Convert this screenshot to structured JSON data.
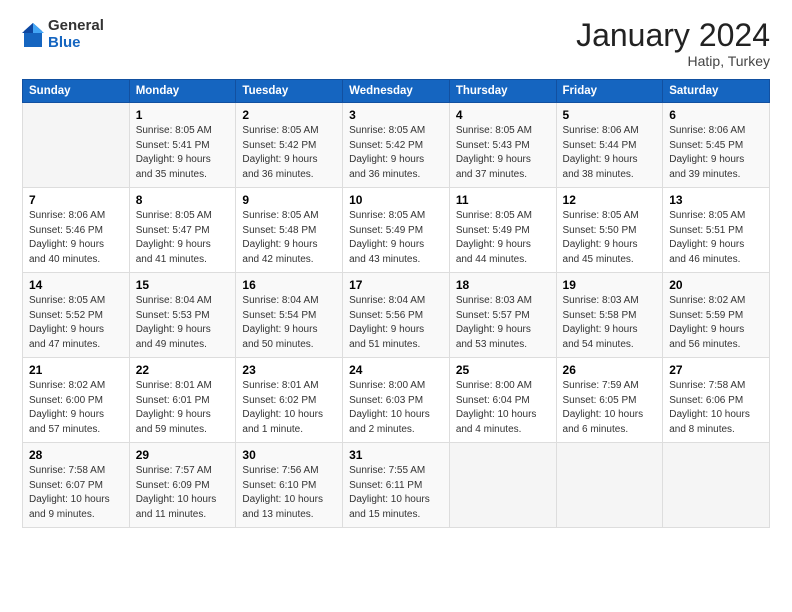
{
  "header": {
    "logo": {
      "general": "General",
      "blue": "Blue"
    },
    "title": "January 2024",
    "location": "Hatip, Turkey"
  },
  "days_of_week": [
    "Sunday",
    "Monday",
    "Tuesday",
    "Wednesday",
    "Thursday",
    "Friday",
    "Saturday"
  ],
  "weeks": [
    [
      {
        "day": "",
        "sunrise": "",
        "sunset": "",
        "daylight": ""
      },
      {
        "day": "1",
        "sunrise": "Sunrise: 8:05 AM",
        "sunset": "Sunset: 5:41 PM",
        "daylight": "Daylight: 9 hours and 35 minutes."
      },
      {
        "day": "2",
        "sunrise": "Sunrise: 8:05 AM",
        "sunset": "Sunset: 5:42 PM",
        "daylight": "Daylight: 9 hours and 36 minutes."
      },
      {
        "day": "3",
        "sunrise": "Sunrise: 8:05 AM",
        "sunset": "Sunset: 5:42 PM",
        "daylight": "Daylight: 9 hours and 36 minutes."
      },
      {
        "day": "4",
        "sunrise": "Sunrise: 8:05 AM",
        "sunset": "Sunset: 5:43 PM",
        "daylight": "Daylight: 9 hours and 37 minutes."
      },
      {
        "day": "5",
        "sunrise": "Sunrise: 8:06 AM",
        "sunset": "Sunset: 5:44 PM",
        "daylight": "Daylight: 9 hours and 38 minutes."
      },
      {
        "day": "6",
        "sunrise": "Sunrise: 8:06 AM",
        "sunset": "Sunset: 5:45 PM",
        "daylight": "Daylight: 9 hours and 39 minutes."
      }
    ],
    [
      {
        "day": "7",
        "sunrise": "Sunrise: 8:06 AM",
        "sunset": "Sunset: 5:46 PM",
        "daylight": "Daylight: 9 hours and 40 minutes."
      },
      {
        "day": "8",
        "sunrise": "Sunrise: 8:05 AM",
        "sunset": "Sunset: 5:47 PM",
        "daylight": "Daylight: 9 hours and 41 minutes."
      },
      {
        "day": "9",
        "sunrise": "Sunrise: 8:05 AM",
        "sunset": "Sunset: 5:48 PM",
        "daylight": "Daylight: 9 hours and 42 minutes."
      },
      {
        "day": "10",
        "sunrise": "Sunrise: 8:05 AM",
        "sunset": "Sunset: 5:49 PM",
        "daylight": "Daylight: 9 hours and 43 minutes."
      },
      {
        "day": "11",
        "sunrise": "Sunrise: 8:05 AM",
        "sunset": "Sunset: 5:49 PM",
        "daylight": "Daylight: 9 hours and 44 minutes."
      },
      {
        "day": "12",
        "sunrise": "Sunrise: 8:05 AM",
        "sunset": "Sunset: 5:50 PM",
        "daylight": "Daylight: 9 hours and 45 minutes."
      },
      {
        "day": "13",
        "sunrise": "Sunrise: 8:05 AM",
        "sunset": "Sunset: 5:51 PM",
        "daylight": "Daylight: 9 hours and 46 minutes."
      }
    ],
    [
      {
        "day": "14",
        "sunrise": "Sunrise: 8:05 AM",
        "sunset": "Sunset: 5:52 PM",
        "daylight": "Daylight: 9 hours and 47 minutes."
      },
      {
        "day": "15",
        "sunrise": "Sunrise: 8:04 AM",
        "sunset": "Sunset: 5:53 PM",
        "daylight": "Daylight: 9 hours and 49 minutes."
      },
      {
        "day": "16",
        "sunrise": "Sunrise: 8:04 AM",
        "sunset": "Sunset: 5:54 PM",
        "daylight": "Daylight: 9 hours and 50 minutes."
      },
      {
        "day": "17",
        "sunrise": "Sunrise: 8:04 AM",
        "sunset": "Sunset: 5:56 PM",
        "daylight": "Daylight: 9 hours and 51 minutes."
      },
      {
        "day": "18",
        "sunrise": "Sunrise: 8:03 AM",
        "sunset": "Sunset: 5:57 PM",
        "daylight": "Daylight: 9 hours and 53 minutes."
      },
      {
        "day": "19",
        "sunrise": "Sunrise: 8:03 AM",
        "sunset": "Sunset: 5:58 PM",
        "daylight": "Daylight: 9 hours and 54 minutes."
      },
      {
        "day": "20",
        "sunrise": "Sunrise: 8:02 AM",
        "sunset": "Sunset: 5:59 PM",
        "daylight": "Daylight: 9 hours and 56 minutes."
      }
    ],
    [
      {
        "day": "21",
        "sunrise": "Sunrise: 8:02 AM",
        "sunset": "Sunset: 6:00 PM",
        "daylight": "Daylight: 9 hours and 57 minutes."
      },
      {
        "day": "22",
        "sunrise": "Sunrise: 8:01 AM",
        "sunset": "Sunset: 6:01 PM",
        "daylight": "Daylight: 9 hours and 59 minutes."
      },
      {
        "day": "23",
        "sunrise": "Sunrise: 8:01 AM",
        "sunset": "Sunset: 6:02 PM",
        "daylight": "Daylight: 10 hours and 1 minute."
      },
      {
        "day": "24",
        "sunrise": "Sunrise: 8:00 AM",
        "sunset": "Sunset: 6:03 PM",
        "daylight": "Daylight: 10 hours and 2 minutes."
      },
      {
        "day": "25",
        "sunrise": "Sunrise: 8:00 AM",
        "sunset": "Sunset: 6:04 PM",
        "daylight": "Daylight: 10 hours and 4 minutes."
      },
      {
        "day": "26",
        "sunrise": "Sunrise: 7:59 AM",
        "sunset": "Sunset: 6:05 PM",
        "daylight": "Daylight: 10 hours and 6 minutes."
      },
      {
        "day": "27",
        "sunrise": "Sunrise: 7:58 AM",
        "sunset": "Sunset: 6:06 PM",
        "daylight": "Daylight: 10 hours and 8 minutes."
      }
    ],
    [
      {
        "day": "28",
        "sunrise": "Sunrise: 7:58 AM",
        "sunset": "Sunset: 6:07 PM",
        "daylight": "Daylight: 10 hours and 9 minutes."
      },
      {
        "day": "29",
        "sunrise": "Sunrise: 7:57 AM",
        "sunset": "Sunset: 6:09 PM",
        "daylight": "Daylight: 10 hours and 11 minutes."
      },
      {
        "day": "30",
        "sunrise": "Sunrise: 7:56 AM",
        "sunset": "Sunset: 6:10 PM",
        "daylight": "Daylight: 10 hours and 13 minutes."
      },
      {
        "day": "31",
        "sunrise": "Sunrise: 7:55 AM",
        "sunset": "Sunset: 6:11 PM",
        "daylight": "Daylight: 10 hours and 15 minutes."
      },
      {
        "day": "",
        "sunrise": "",
        "sunset": "",
        "daylight": ""
      },
      {
        "day": "",
        "sunrise": "",
        "sunset": "",
        "daylight": ""
      },
      {
        "day": "",
        "sunrise": "",
        "sunset": "",
        "daylight": ""
      }
    ]
  ]
}
